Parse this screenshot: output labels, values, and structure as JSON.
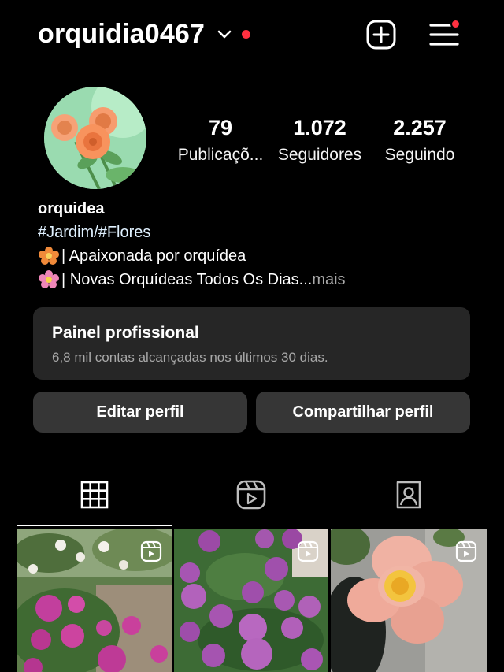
{
  "header": {
    "username": "orquidia0467"
  },
  "stats": {
    "posts": {
      "value": "79",
      "label": "Publicaçõ..."
    },
    "followers": {
      "value": "1.072",
      "label": "Seguidores"
    },
    "following": {
      "value": "2.257",
      "label": "Seguindo"
    }
  },
  "bio": {
    "name": "orquidea",
    "hashtags": "#Jardim/#Flores",
    "line1": "| Apaixonada por orquídea",
    "line2": "| Novas Orquídeas Todos Os Dias...",
    "more": " mais",
    "line1_icon": "orange-flower-emoji",
    "line2_icon": "pink-flower-emoji"
  },
  "panel": {
    "title": "Painel profissional",
    "subtitle": "6,8 mil contas alcançadas nos últimos 30 dias."
  },
  "buttons": {
    "edit": "Editar perfil",
    "share": "Compartilhar perfil"
  },
  "tabs": [
    {
      "icon": "grid-icon",
      "active": true
    },
    {
      "icon": "reels-icon",
      "active": false
    },
    {
      "icon": "tagged-icon",
      "active": false
    }
  ],
  "grid": [
    {
      "subject": "rose garden with pink and white roses",
      "type": "reel"
    },
    {
      "subject": "purple roses bush",
      "type": "reel"
    },
    {
      "subject": "pink flower close-up",
      "type": "reel"
    }
  ],
  "colors": {
    "background": "#000000",
    "card": "#262626",
    "button": "#363636",
    "notification": "#ff3040",
    "muted_text": "#a8a8a8"
  }
}
